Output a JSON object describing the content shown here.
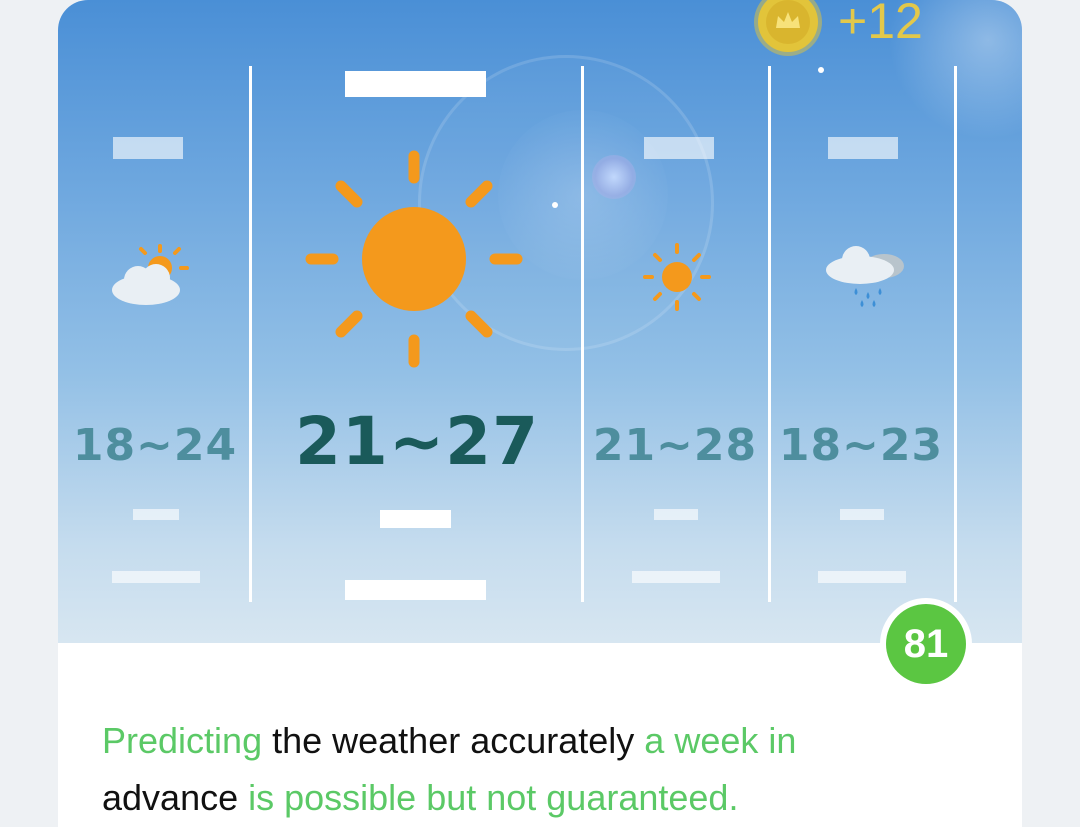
{
  "reward": {
    "coin_icon": "crown-coin-icon",
    "label": "+12"
  },
  "forecast": [
    {
      "temp": "18~24",
      "icon": "partly-cloudy-icon"
    },
    {
      "temp": "21~27",
      "icon": "sun-icon",
      "selected": true
    },
    {
      "temp": "21~28",
      "icon": "sun-icon"
    },
    {
      "temp": "18~23",
      "icon": "rain-cloud-icon"
    }
  ],
  "score_badge": "81",
  "fact": {
    "part1": "Predicting",
    "part2": " the weather accurately ",
    "part3": "a week in",
    "part4": "advance",
    "part5": " is possible but not guaranteed."
  },
  "colors": {
    "highlight": "#5bc966",
    "badge": "#5bc642",
    "sun": "#f4991c",
    "coin": "#e2c43a"
  }
}
